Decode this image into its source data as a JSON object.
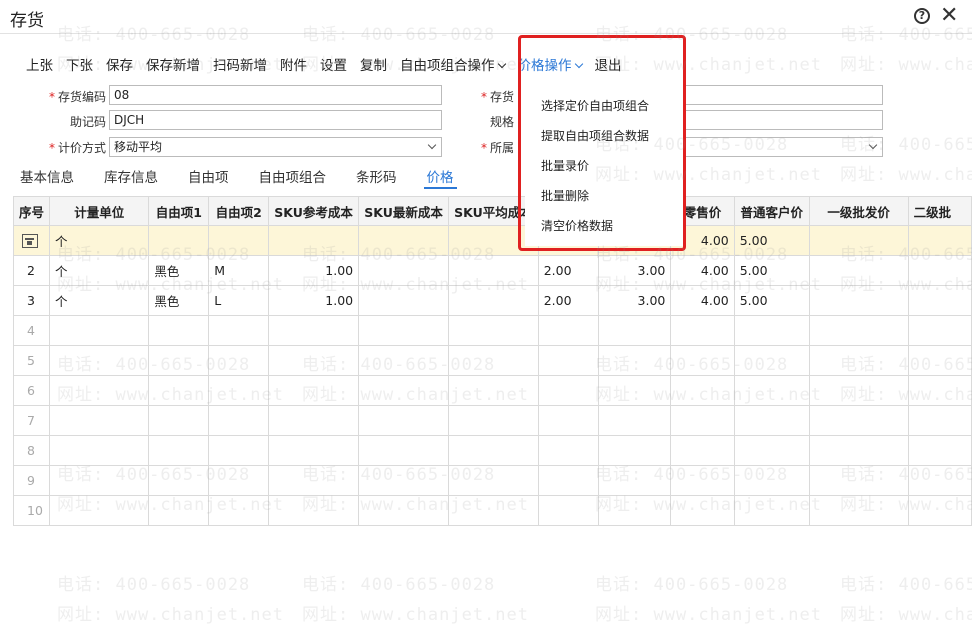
{
  "window": {
    "title": "存货"
  },
  "toolbar": {
    "prev": "上张",
    "next": "下张",
    "save": "保存",
    "save_new": "保存新增",
    "scan_new": "扫码新增",
    "attachment": "附件",
    "settings": "设置",
    "copy": "复制",
    "combo_ops": "自由项组合操作",
    "price_ops": "价格操作",
    "exit": "退出"
  },
  "form": {
    "code_label": "存货编码",
    "code_value": "08",
    "mnemonic_label": "助记码",
    "mnemonic_value": "DJCH",
    "pricing_label": "计价方式",
    "pricing_value": "移动平均",
    "name_label": "存货",
    "spec_label": "规格",
    "category_label": "所属"
  },
  "tabs": [
    "基本信息",
    "库存信息",
    "自由项",
    "自由项组合",
    "条形码",
    "价格"
  ],
  "grid": {
    "headers": [
      "序号",
      "计量单位",
      "自由项1",
      "自由项2",
      "SKU参考成本",
      "SKU最新成本",
      "SKU平均成本",
      "",
      "",
      "零售价",
      "普通客户价",
      "一级批发价",
      "二级批"
    ],
    "rows": [
      {
        "seq": "",
        "unit": "个",
        "f1": "",
        "f2": "",
        "ref_cost": "",
        "latest_cost": "",
        "avg_cost": "",
        "c8": "",
        "c9": "",
        "retail": "4.00",
        "normal": "5.00",
        "wholesale1": "",
        "wholesale2": ""
      },
      {
        "seq": "2",
        "unit": "个",
        "f1": "黑色",
        "f2": "M",
        "ref_cost": "1.00",
        "latest_cost": "",
        "avg_cost": "",
        "c8": "2.00",
        "c9": "3.00",
        "retail": "4.00",
        "normal": "5.00",
        "wholesale1": "",
        "wholesale2": ""
      },
      {
        "seq": "3",
        "unit": "个",
        "f1": "黑色",
        "f2": "L",
        "ref_cost": "1.00",
        "latest_cost": "",
        "avg_cost": "",
        "c8": "2.00",
        "c9": "3.00",
        "retail": "4.00",
        "normal": "5.00",
        "wholesale1": "",
        "wholesale2": ""
      }
    ],
    "empty_rows": [
      "4",
      "5",
      "6",
      "7",
      "8",
      "9",
      "10"
    ]
  },
  "price_menu": {
    "items": [
      "选择定价自由项组合",
      "提取自由项组合数据",
      "批量录价",
      "批量删除",
      "清空价格数据"
    ]
  },
  "watermark": {
    "phone": "电话: 400-665-0028",
    "site": "网址: www.chanjet.net"
  },
  "colors": {
    "accent": "#2b78d6",
    "highlight": "#e02020",
    "selected_row": "#fdf6d8"
  }
}
